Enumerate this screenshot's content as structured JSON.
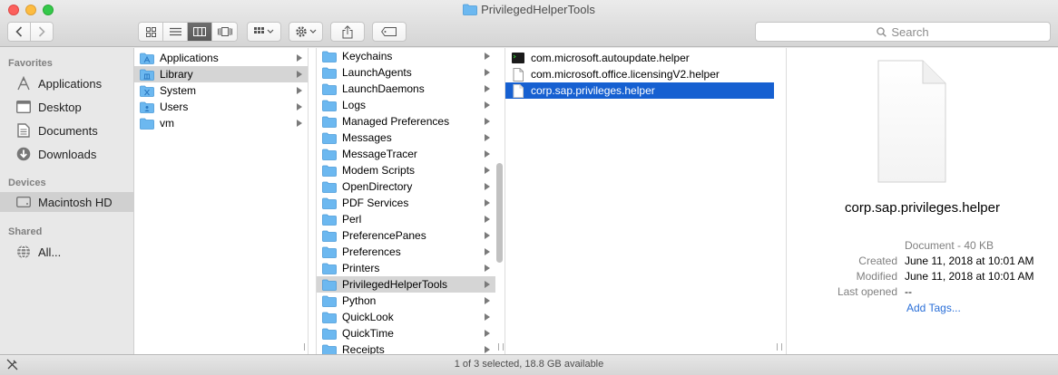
{
  "window": {
    "title": "PrivilegedHelperTools"
  },
  "toolbar": {
    "back_icon": "chevron-left-icon",
    "forward_icon": "chevron-right-icon",
    "view_modes": [
      "icon-view",
      "list-view",
      "column-view",
      "cover-flow-view"
    ],
    "active_view": "column-view",
    "search_placeholder": "Search"
  },
  "sidebar": {
    "favorites_title": "Favorites",
    "favorites": [
      {
        "label": "Applications",
        "icon": "applications-icon"
      },
      {
        "label": "Desktop",
        "icon": "desktop-icon"
      },
      {
        "label": "Documents",
        "icon": "documents-icon"
      },
      {
        "label": "Downloads",
        "icon": "downloads-icon"
      }
    ],
    "devices_title": "Devices",
    "devices": [
      {
        "label": "Macintosh HD",
        "icon": "hard-drive-icon"
      }
    ],
    "shared_title": "Shared",
    "shared": [
      {
        "label": "All...",
        "icon": "network-icon"
      }
    ]
  },
  "column1": {
    "items": [
      "Applications",
      "Library",
      "System",
      "Users",
      "vm"
    ],
    "selected": "Library"
  },
  "column2": {
    "items": [
      "Keychains",
      "LaunchAgents",
      "LaunchDaemons",
      "Logs",
      "Managed Preferences",
      "Messages",
      "MessageTracer",
      "Modem Scripts",
      "OpenDirectory",
      "PDF Services",
      "Perl",
      "PreferencePanes",
      "Preferences",
      "Printers",
      "PrivilegedHelperTools",
      "Python",
      "QuickLook",
      "QuickTime",
      "Receipts"
    ],
    "selected": "PrivilegedHelperTools"
  },
  "column3": {
    "items": [
      {
        "label": "com.microsoft.autoupdate.helper",
        "icon": "executable-icon"
      },
      {
        "label": "com.microsoft.office.licensingV2.helper",
        "icon": "document-icon"
      },
      {
        "label": "corp.sap.privileges.helper",
        "icon": "document-icon"
      }
    ],
    "selected": "corp.sap.privileges.helper"
  },
  "preview": {
    "name": "corp.sap.privileges.helper",
    "kind": "Document - 40 KB",
    "created_label": "Created",
    "created": "June 11, 2018 at 10:01 AM",
    "modified_label": "Modified",
    "modified": "June 11, 2018 at 10:01 AM",
    "last_opened_label": "Last opened",
    "last_opened": "--",
    "add_tags": "Add Tags..."
  },
  "status": {
    "text": "1 of 3 selected, 18.8 GB available"
  },
  "colors": {
    "selection_blue": "#1660d1",
    "folder_blue": "#6cb8f0",
    "link": "#2a6fd8"
  }
}
